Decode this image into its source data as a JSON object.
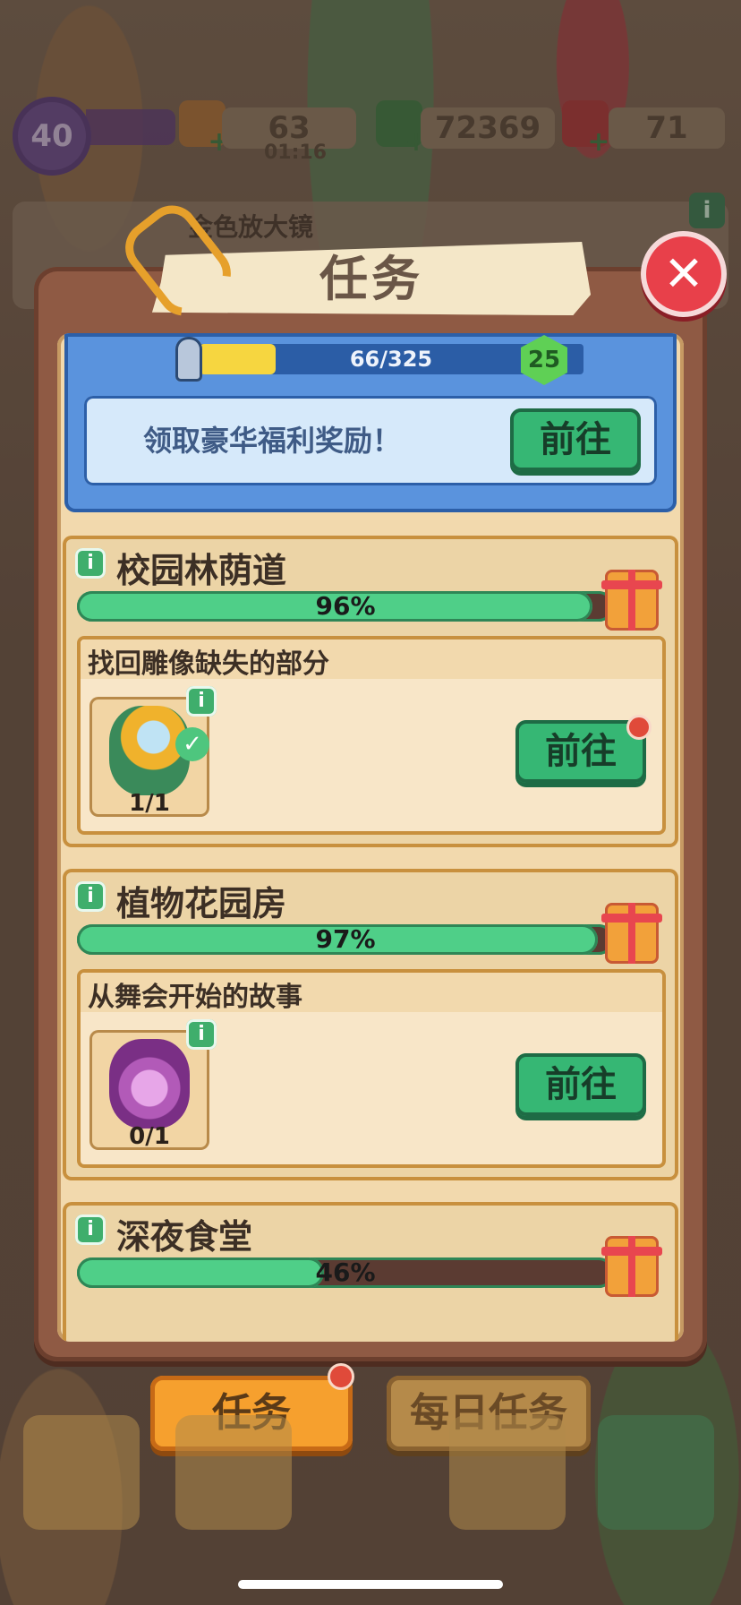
{
  "hud": {
    "level": "40",
    "energy": "63",
    "energy_timer": "01:16",
    "cash": "72369",
    "gems": "71"
  },
  "behind_panel": {
    "title": "金色放大镜"
  },
  "dialog": {
    "title": "任务",
    "close_symbol": "✕"
  },
  "progress": {
    "current_text": "66/325",
    "fill_fraction": 0.2,
    "level": "25",
    "reward_text": "领取豪华福利奖励！",
    "go_label": "前往"
  },
  "tasks": [
    {
      "area": "校园林荫道",
      "percent": "96%",
      "percent_value": 96,
      "quest": "找回雕像缺失的部分",
      "item": "magnifier-icon",
      "count": "1/1",
      "completed": true,
      "go_label": "前往",
      "has_notification": true
    },
    {
      "area": "植物花园房",
      "percent": "97%",
      "percent_value": 97,
      "quest": "从舞会开始的故事",
      "item": "perfume-bottle-icon",
      "count": "0/1",
      "completed": false,
      "go_label": "前往",
      "has_notification": false
    },
    {
      "area": "深夜食堂",
      "percent": "46%",
      "percent_value": 46
    }
  ],
  "tabs": {
    "tasks_label": "任务",
    "daily_label": "每日任务"
  },
  "colors": {
    "accent_green": "#36b774",
    "panel_brown": "#8f5a44",
    "blue_card": "#5a93dd",
    "tab_active": "#f6a02e"
  }
}
